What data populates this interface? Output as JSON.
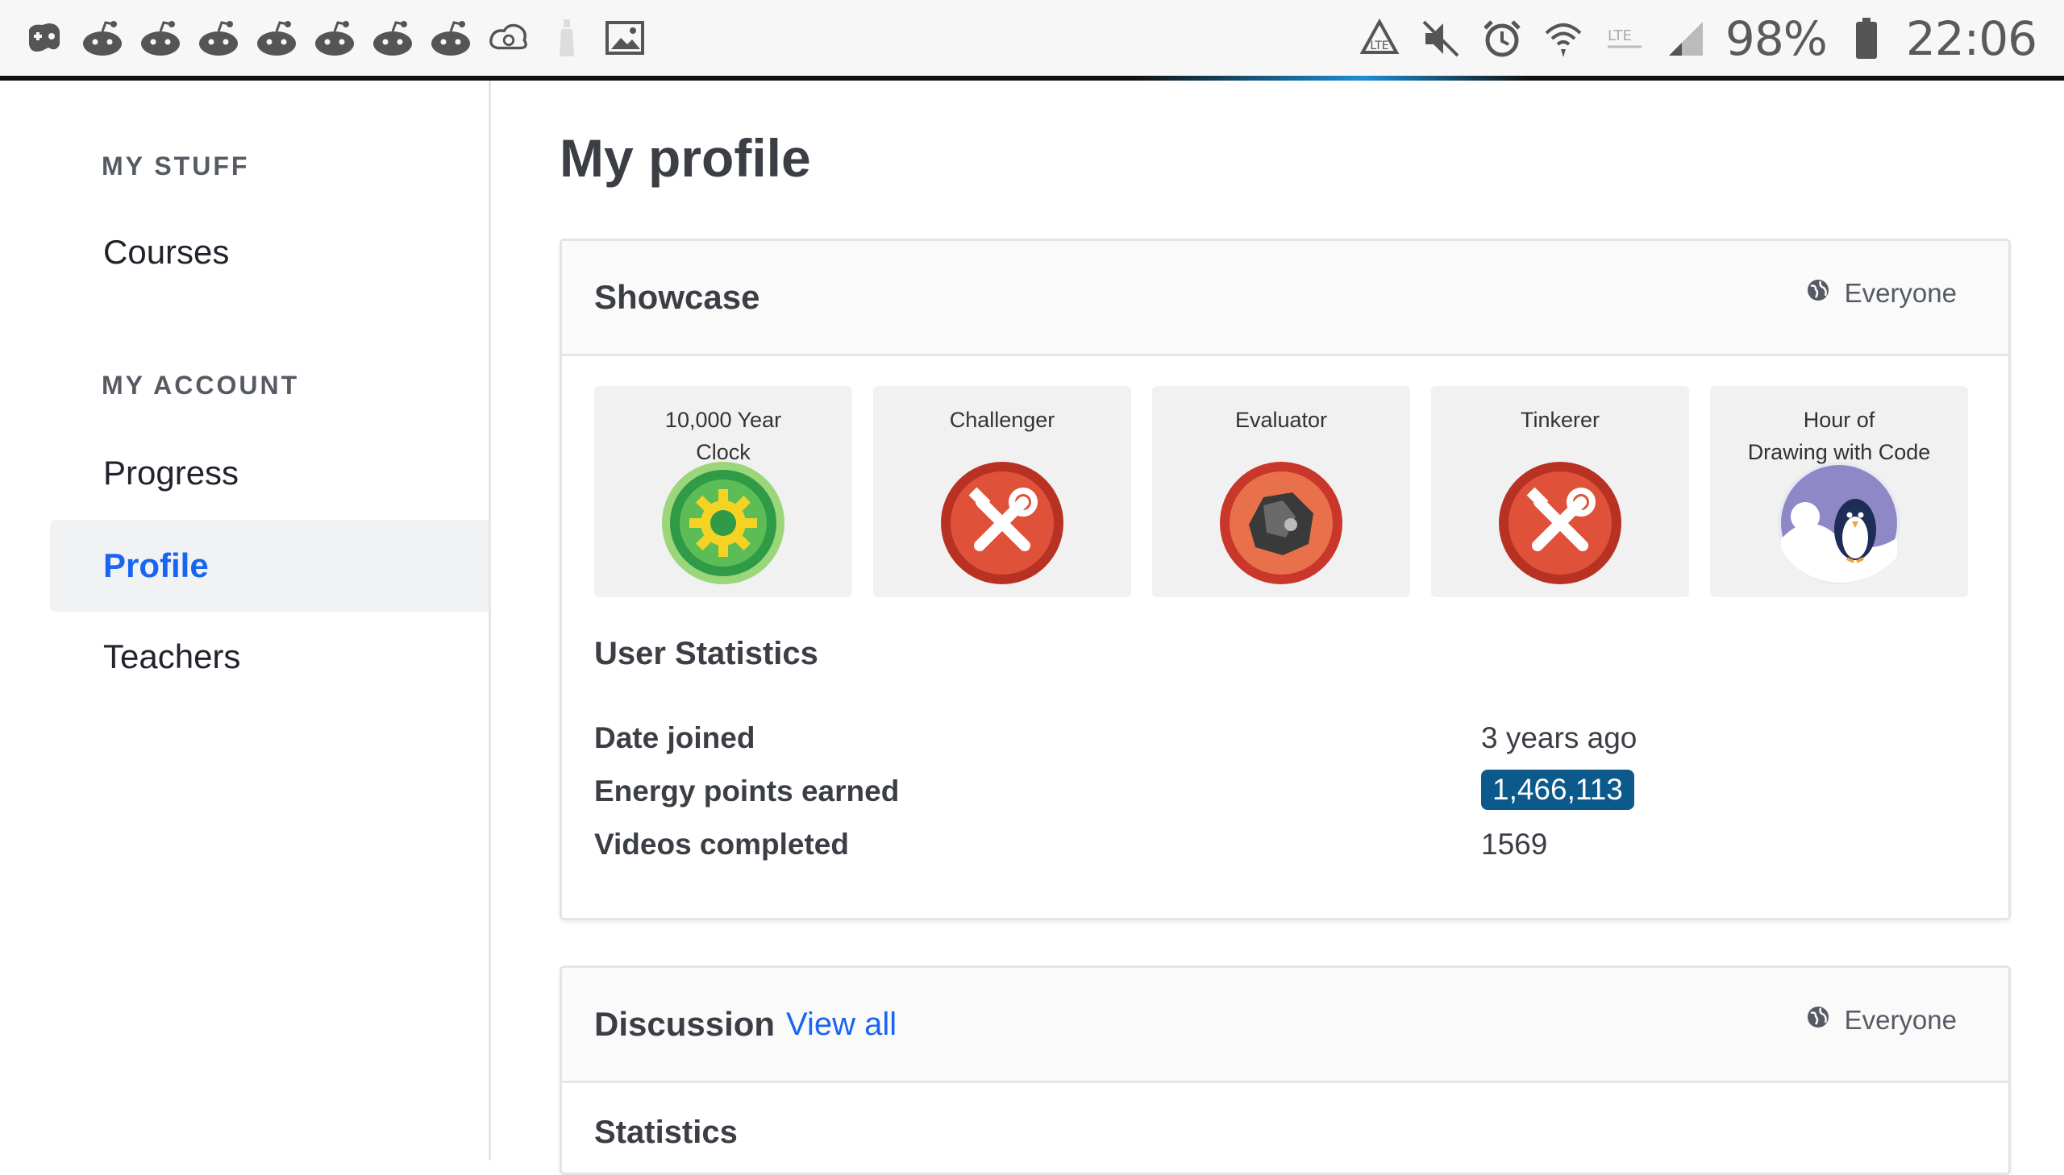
{
  "status_bar": {
    "left_icons": [
      "game-controller-icon",
      "reddit-icon",
      "reddit-icon",
      "reddit-icon",
      "reddit-icon",
      "reddit-icon",
      "reddit-icon",
      "reddit-icon",
      "sync-cloud-icon",
      "bottle-icon",
      "image-icon"
    ],
    "right_icons": [
      "recycle-icon",
      "mute-icon",
      "alarm-icon",
      "wifi-icon",
      "lte-icon",
      "signal-icon"
    ],
    "battery_text": "98%",
    "time": "22:06"
  },
  "sidebar": {
    "my_stuff_header": "MY STUFF",
    "courses_label": "Courses",
    "my_account_header": "MY ACCOUNT",
    "items": [
      {
        "label": "Progress",
        "active": false
      },
      {
        "label": "Profile",
        "active": true
      },
      {
        "label": "Teachers",
        "active": false
      }
    ]
  },
  "main": {
    "page_title": "My profile",
    "showcase": {
      "title": "Showcase",
      "visibility": "Everyone",
      "badges": [
        {
          "name_line1": "10,000 Year",
          "name_line2": "Clock",
          "icon": "gear-badge-icon"
        },
        {
          "name_line1": "Challenger",
          "name_line2": "",
          "icon": "tools-badge-icon"
        },
        {
          "name_line1": "Evaluator",
          "name_line2": "",
          "icon": "meteorite-badge-icon"
        },
        {
          "name_line1": "Tinkerer",
          "name_line2": "",
          "icon": "tools-badge-icon"
        },
        {
          "name_line1": "Hour of",
          "name_line2": "Drawing with Code",
          "icon": "penguin-badge-icon"
        }
      ]
    },
    "user_statistics": {
      "title": "User Statistics",
      "rows": [
        {
          "label": "Date joined",
          "value": "3 years ago"
        },
        {
          "label": "Energy points earned",
          "value": "1,466,113"
        },
        {
          "label": "Videos completed",
          "value": "1569"
        }
      ]
    },
    "discussion": {
      "title": "Discussion",
      "view_all": "View all",
      "visibility": "Everyone",
      "statistics_title": "Statistics"
    }
  },
  "colors": {
    "link_blue": "#1865f2",
    "points_pill": "#0c5a8b",
    "badge_red": "#d8432c",
    "badge_green": "#3fae49"
  }
}
